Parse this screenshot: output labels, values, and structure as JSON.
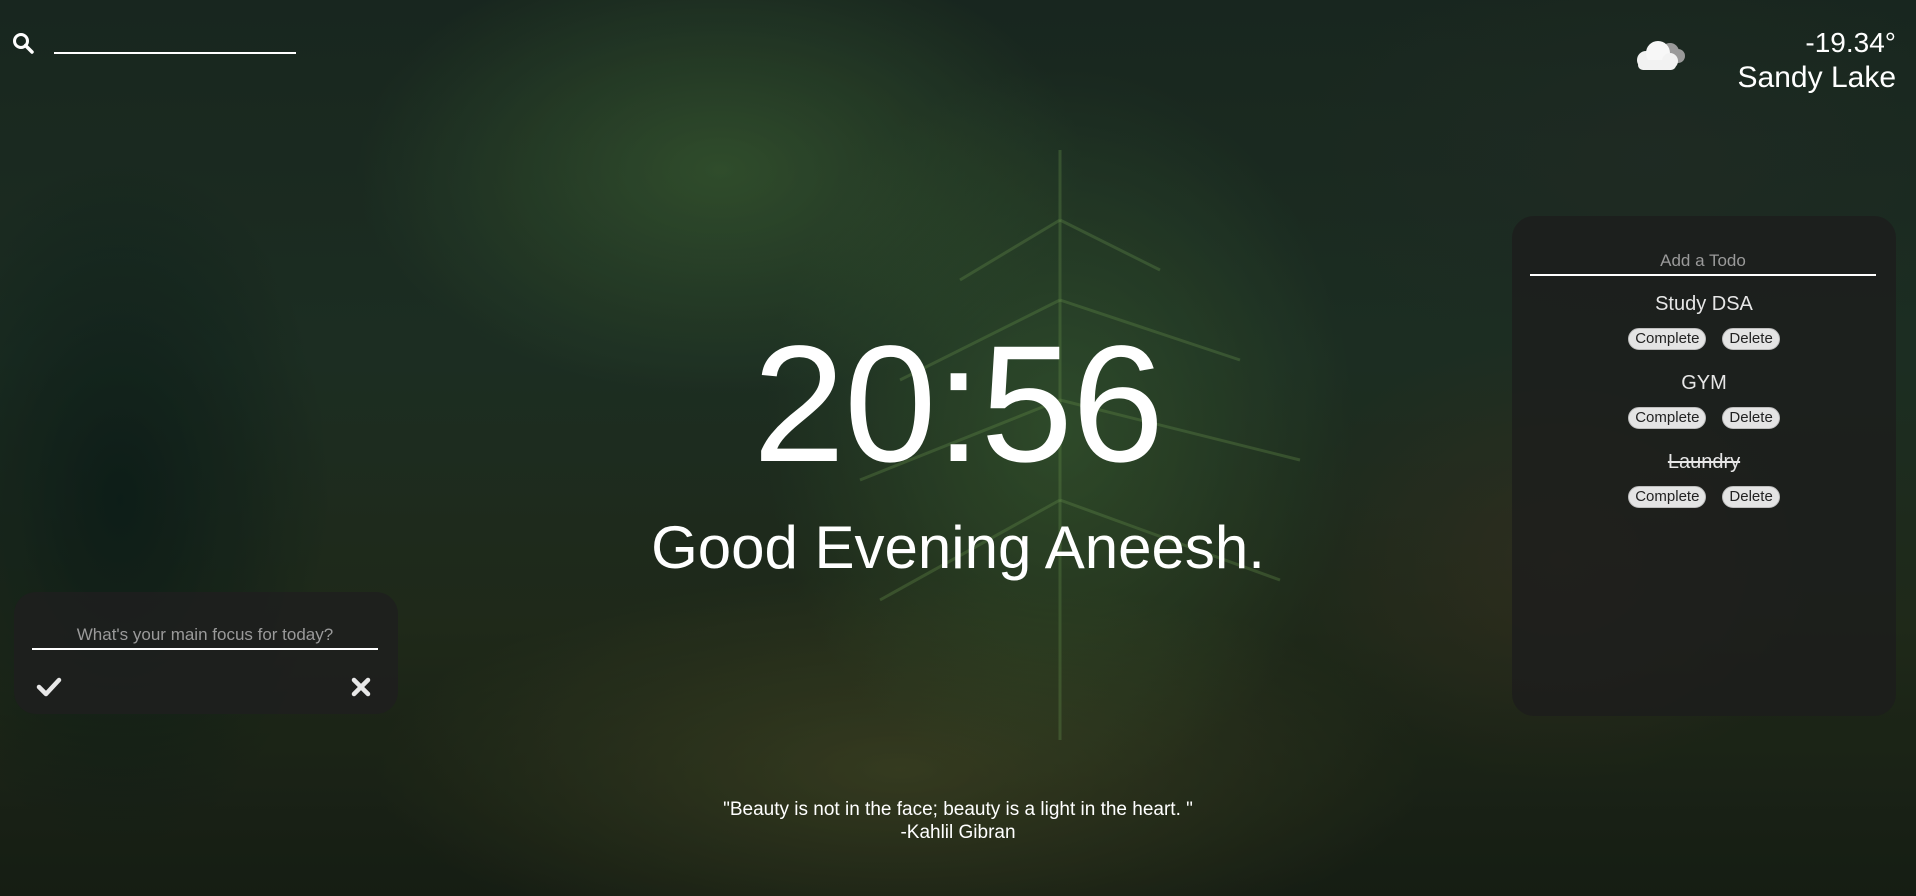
{
  "search": {
    "icon": "search-icon",
    "value": "",
    "placeholder": ""
  },
  "weather": {
    "icon": "cloud-icon",
    "temperature": "-19.34°",
    "city": "Sandy Lake"
  },
  "clock": {
    "time": "20:56"
  },
  "greeting": {
    "text": "Good Evening Aneesh."
  },
  "focus": {
    "placeholder": "What's your main focus for today?",
    "value": "",
    "confirm_icon": "check-icon",
    "cancel_icon": "close-icon"
  },
  "todo": {
    "placeholder": "Add a Todo",
    "complete_label": "Complete",
    "delete_label": "Delete",
    "items": [
      {
        "text": "Study DSA",
        "completed": false
      },
      {
        "text": "GYM",
        "completed": false
      },
      {
        "text": "Laundry",
        "completed": true
      }
    ]
  },
  "quote": {
    "text": "\"Beauty is not in the face; beauty is a light in the heart. \"",
    "author": "-Kahlil Gibran"
  },
  "colors": {
    "panel": "#1e1e1e",
    "text": "#ffffff",
    "button": "#e4e4e4"
  }
}
